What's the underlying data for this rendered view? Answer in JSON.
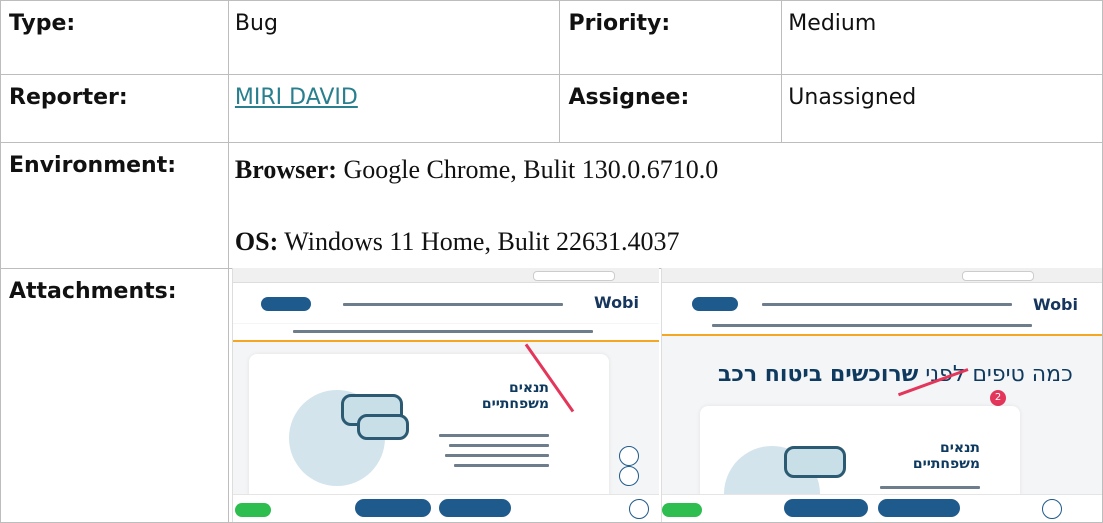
{
  "rows": {
    "type": {
      "label": "Type:",
      "value": "Bug"
    },
    "priority": {
      "label": "Priority:",
      "value": "Medium"
    },
    "reporter": {
      "label": "Reporter:",
      "value": "MIRI DAVID"
    },
    "assignee": {
      "label": "Assignee:",
      "value": "Unassigned"
    },
    "environment": {
      "label": "Environment:",
      "browser_label": "Browser:",
      "browser_value": " Google Chrome, Bulit 130.0.6710.0",
      "os_label": "OS:",
      "os_value": " Windows 11 Home, Bulit 22631.4037"
    },
    "attachments": {
      "label": "Attachments:"
    }
  },
  "attachment_shots": {
    "logo": "Wobi",
    "left_heading_line1": "תנאים",
    "left_heading_line2": "משפחתיים",
    "right_banner_plain": "כמה טיפים לפני ",
    "right_banner_bold": "שרוכשים ביטוח רכב",
    "right_badge": "2",
    "right_heading_line1": "תנאים",
    "right_heading_line2": "משפחתיים"
  }
}
